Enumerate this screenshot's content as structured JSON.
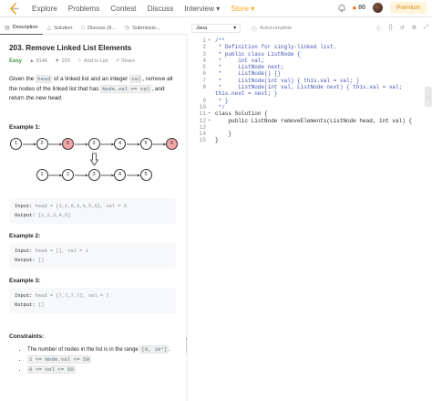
{
  "nav": {
    "items": [
      "Explore",
      "Problems",
      "Contest",
      "Discuss",
      "Interview ▾",
      "Store ▾"
    ],
    "streak": "86",
    "premium": "Premium"
  },
  "tabs": {
    "description": "Description",
    "solution": "Solution",
    "discuss": "Discuss (9...",
    "submissions": "Submissio..."
  },
  "problem": {
    "title": "203. Remove Linked List Elements",
    "difficulty": "Easy",
    "likes": "8146",
    "dislikes": "233",
    "add_to_list": "Add to List",
    "share": "Share",
    "desc_1": "Given the ",
    "code_head": "head",
    "desc_2": " of a linked list and an integer ",
    "code_val": "val",
    "desc_3": ", remove all the nodes of the linked list that has ",
    "code_cond": "Node.val == val",
    "desc_4": ", and return ",
    "desc_5": "the new head",
    "desc_6": "."
  },
  "examples": [
    {
      "heading": "Example 1:",
      "input_label": "Input:",
      "input": "head = [1,2,6,3,4,5,6], val = 6",
      "output_label": "Output:",
      "output": "[1,2,3,4,5]"
    },
    {
      "heading": "Example 2:",
      "input_label": "Input:",
      "input": "head = [], val = 1",
      "output_label": "Output:",
      "output": "[]"
    },
    {
      "heading": "Example 3:",
      "input_label": "Input:",
      "input": "head = [7,7,7,7], val = 7",
      "output_label": "Output:",
      "output": "[]"
    }
  ],
  "diagram": {
    "top_row": [
      "1",
      "2",
      "6",
      "3",
      "4",
      "5",
      "6"
    ],
    "top_removed": [
      false,
      false,
      true,
      false,
      false,
      false,
      true
    ],
    "bottom_row": [
      "1",
      "2",
      "3",
      "4",
      "5"
    ]
  },
  "constraints": {
    "heading": "Constraints:",
    "c1_pre": "The number of nodes in the list is in the range ",
    "c1_code": "[0, 10⁴]",
    "c1_post": ".",
    "c2": "1 <= Node.val <= 50",
    "c3": "0 <= val <= 50"
  },
  "editor": {
    "language": "Java",
    "autocomplete": "Autocomplete",
    "lines": [
      {
        "n": "1",
        "fold": "▾",
        "text": "/**",
        "comment": true
      },
      {
        "n": "2",
        "fold": "",
        "text": " * Definition for singly-linked list.",
        "comment": true
      },
      {
        "n": "3",
        "fold": "",
        "text": " * public class ListNode {",
        "comment": true
      },
      {
        "n": "4",
        "fold": "",
        "text": " *     int val;",
        "comment": true
      },
      {
        "n": "5",
        "fold": "",
        "text": " *     ListNode next;",
        "comment": true
      },
      {
        "n": "6",
        "fold": "",
        "text": " *     ListNode() {}",
        "comment": true
      },
      {
        "n": "7",
        "fold": "",
        "text": " *     ListNode(int val) { this.val = val; }",
        "comment": true
      },
      {
        "n": "8",
        "fold": "",
        "text": " *     ListNode(int val, ListNode next) { this.val = val;",
        "comment": true
      },
      {
        "n": "",
        "fold": "",
        "text": "this.next = next; }",
        "comment": true
      },
      {
        "n": "9",
        "fold": "",
        "text": " * }",
        "comment": true
      },
      {
        "n": "10",
        "fold": "",
        "text": " */",
        "comment": true
      },
      {
        "n": "11",
        "fold": "▾",
        "text": "class Solution {",
        "comment": false
      },
      {
        "n": "12",
        "fold": "▾",
        "text": "    public ListNode removeElements(ListNode head, int val) {",
        "comment": false
      },
      {
        "n": "13",
        "fold": "",
        "text": "",
        "comment": false
      },
      {
        "n": "14",
        "fold": "",
        "text": "    }",
        "comment": false
      },
      {
        "n": "15",
        "fold": "",
        "text": "}",
        "comment": false
      }
    ]
  },
  "colors": {
    "accent": "#ffa116",
    "easy": "#43a047",
    "removed_node": "#f4a7a7",
    "comment": "#3f51b5"
  }
}
